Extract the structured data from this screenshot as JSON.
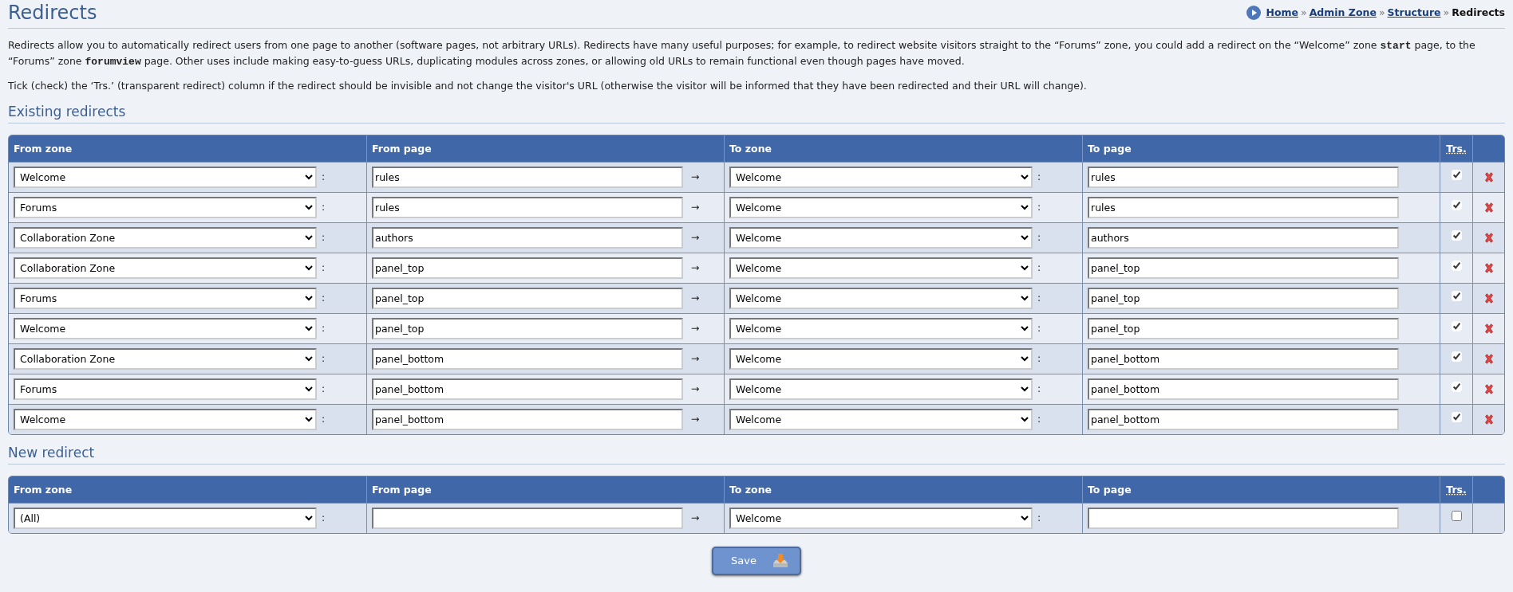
{
  "page_title": "Redirects",
  "breadcrumb": [
    {
      "label": "Home",
      "link": true
    },
    {
      "separator": "»",
      "label": "Admin Zone",
      "link": true
    },
    {
      "separator": "»",
      "label": "Structure",
      "link": true
    },
    {
      "separator": "»",
      "label": "Redirects",
      "link": false
    }
  ],
  "intro": [
    "Redirects allow you to automatically redirect users from one page to another (software pages, not arbitrary URLs). Redirects have many useful purposes; for example, to redirect website visitors straight to the “Forums” zone, you could add a redirect on the “Welcome” zone **start** page, to the “Forums” zone **forumview** page. Other uses include making easy-to-guess URLs, duplicating modules across zones, or allowing old URLs to remain functional even though pages have moved.",
    "Tick (check) the ‘Trs.’ (transparent redirect) column if the redirect should be invisible and not change the visitor's URL (otherwise the visitor will be informed that they have been redirected and their URL will change)."
  ],
  "existing": {
    "heading": "Existing redirects",
    "columns": [
      "From zone",
      "From page",
      "To zone",
      "To page",
      "Trs."
    ],
    "rows": [
      {
        "from_zone": "Welcome",
        "colon_1": ":",
        "from_page": "rules",
        "arrow": "→",
        "to_zone": "Welcome",
        "colon_2": ":",
        "to_page": "rules",
        "checked": true
      },
      {
        "from_zone": "Forums",
        "colon_1": ":",
        "from_page": "rules",
        "arrow": "→",
        "to_zone": "Welcome",
        "colon_2": ":",
        "to_page": "rules",
        "checked": true
      },
      {
        "from_zone": "Collaboration Zone",
        "colon_1": ":",
        "from_page": "authors",
        "arrow": "→",
        "to_zone": "Welcome",
        "colon_2": ":",
        "to_page": "authors",
        "checked": true
      },
      {
        "from_zone": "Collaboration Zone",
        "colon_1": ":",
        "from_page": "panel_top",
        "arrow": "→",
        "to_zone": "Welcome",
        "colon_2": ":",
        "to_page": "panel_top",
        "checked": true
      },
      {
        "from_zone": "Forums",
        "colon_1": ":",
        "from_page": "panel_top",
        "arrow": "→",
        "to_zone": "Welcome",
        "colon_2": ":",
        "to_page": "panel_top",
        "checked": true
      },
      {
        "from_zone": "Welcome",
        "colon_1": ":",
        "from_page": "panel_top",
        "arrow": "→",
        "to_zone": "Welcome",
        "colon_2": ":",
        "to_page": "panel_top",
        "checked": true
      },
      {
        "from_zone": "Collaboration Zone",
        "colon_1": ":",
        "from_page": "panel_bottom",
        "arrow": "→",
        "to_zone": "Welcome",
        "colon_2": ":",
        "to_page": "panel_bottom",
        "checked": true
      },
      {
        "from_zone": "Forums",
        "colon_1": ":",
        "from_page": "panel_bottom",
        "arrow": "→",
        "to_zone": "Welcome",
        "colon_2": ":",
        "to_page": "panel_bottom",
        "checked": true
      },
      {
        "from_zone": "Welcome",
        "colon_1": ":",
        "from_page": "panel_bottom",
        "arrow": "→",
        "to_zone": "Welcome",
        "colon_2": ":",
        "to_page": "panel_bottom",
        "checked": true
      }
    ]
  },
  "new": {
    "heading": "New redirect",
    "columns": [
      "From zone",
      "From page",
      "To zone",
      "To page",
      "Trs."
    ],
    "rows": [
      {
        "from_zone": "(All)",
        "colon_1": ":",
        "arrow": "→",
        "to_zone": "Welcome",
        "colon_2": ":",
        "checked": false
      }
    ]
  },
  "save_button": "Save"
}
